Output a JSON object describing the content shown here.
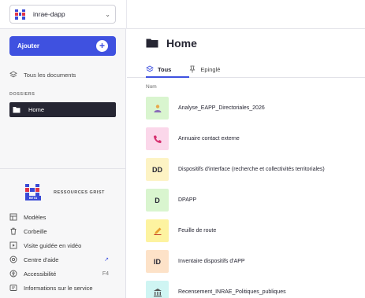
{
  "header": {
    "org_name": "inrae-dapp"
  },
  "sidebar": {
    "add_label": "Ajouter",
    "add_plus": "+",
    "all_docs": "Tous les documents",
    "section_title": "DOSSIERS",
    "home_label": "Home",
    "resources_title": "RESSOURCES GRIST",
    "beta_tag": "BETA",
    "resources": [
      {
        "label": "Modèles",
        "icon": "templates-icon",
        "trail": ""
      },
      {
        "label": "Corbeille",
        "icon": "trash-icon",
        "trail": ""
      },
      {
        "label": "Visite guidée en vidéo",
        "icon": "video-icon",
        "trail": ""
      },
      {
        "label": "Centre d'aide",
        "icon": "help-icon",
        "trail": "↗"
      },
      {
        "label": "Accessibilité",
        "icon": "accessibility-icon",
        "trail": "F4"
      },
      {
        "label": "Informations sur le service",
        "icon": "info-icon",
        "trail": ""
      }
    ]
  },
  "main": {
    "title": "Home",
    "tabs": [
      {
        "label": "Tous",
        "icon": "all-icon",
        "active": true
      },
      {
        "label": "Epinglé",
        "icon": "pin-icon",
        "active": false
      }
    ],
    "column_header": "Nom",
    "documents": [
      {
        "name": "Analyse_EAPP_Directoriales_2026",
        "thumb_text": "",
        "thumb_icon": "person-icon",
        "thumb_color": "#d9f5cf"
      },
      {
        "name": "Annuaire contact externe",
        "thumb_text": "",
        "thumb_icon": "phone-icon",
        "thumb_color": "#fbd7ea"
      },
      {
        "name": "Dispositifs d'interface (recherche et collectivités territoriales)",
        "thumb_text": "DD",
        "thumb_icon": "",
        "thumb_color": "#fdf3c4"
      },
      {
        "name": "DPAPP",
        "thumb_text": "D",
        "thumb_icon": "",
        "thumb_color": "#d9f5cf"
      },
      {
        "name": "Feuille de route",
        "thumb_text": "",
        "thumb_icon": "pencil-icon",
        "thumb_color": "#fdf3a0"
      },
      {
        "name": "Inventaire dispositifs d'APP",
        "thumb_text": "ID",
        "thumb_icon": "",
        "thumb_color": "#fde2c8"
      },
      {
        "name": "Recensement_INRAE_Politiques_publiques",
        "thumb_text": "",
        "thumb_icon": "building-icon",
        "thumb_color": "#cff5f3"
      }
    ]
  },
  "colors": {
    "accent": "#3f51e0",
    "active_nav": "#262633"
  }
}
